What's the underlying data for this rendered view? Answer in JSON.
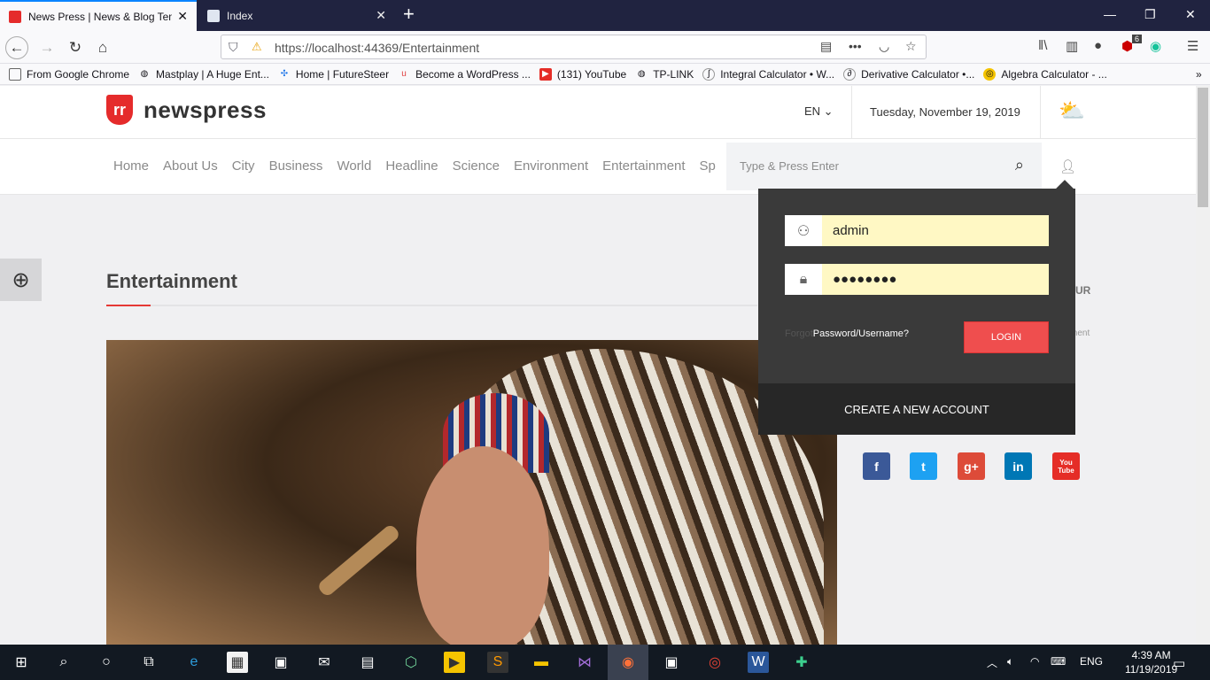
{
  "browser": {
    "tabs": [
      {
        "label": "News Press | News & Blog Temp",
        "close": "✕"
      },
      {
        "label": "Index",
        "close": "✕"
      }
    ],
    "new_tab": "+",
    "window_controls": {
      "minimize": "—",
      "restore": "❐",
      "close": "✕"
    },
    "url": "https://localhost:44369/Entertainment",
    "url_icons": {
      "reader": "reader-icon",
      "more": "•••",
      "pocket": "pocket-icon",
      "bookmark": "☆"
    },
    "toolbar_icons": [
      "library-icon",
      "sidebar-icon",
      "account-icon",
      "adblock-icon",
      "grammarly-icon",
      "menu-icon"
    ],
    "adblock_count": "6",
    "bookmarks": [
      {
        "label": "From Google Chrome",
        "icon": "folder-icon"
      },
      {
        "label": "Mastplay | A Huge Ent...",
        "icon": "globe-icon"
      },
      {
        "label": "Home | FutureSteer",
        "icon": "futuresteer-icon"
      },
      {
        "label": "Become a WordPress ...",
        "icon": "upwork-icon"
      },
      {
        "label": "(131) YouTube",
        "icon": "youtube-icon"
      },
      {
        "label": "TP-LINK",
        "icon": "globe-icon"
      },
      {
        "label": "Integral Calculator • W...",
        "icon": "calculator-icon"
      },
      {
        "label": "Derivative Calculator •...",
        "icon": "calculator-icon"
      },
      {
        "label": "Algebra Calculator - ...",
        "icon": "algebra-icon"
      }
    ],
    "bookmarks_overflow": "»"
  },
  "site": {
    "logo_text": "newspress",
    "logo_mark": "rr",
    "language": "EN ⌄",
    "date": "Tuesday, November 19, 2019",
    "menu": [
      "Home",
      "About Us",
      "City",
      "Business",
      "World",
      "Headline",
      "Science",
      "Environment",
      "Entertainment",
      "Sp"
    ],
    "search_placeholder": "Type & Press Enter",
    "section_title": "Entertainment",
    "side_text_1": "UR",
    "side_text_2": "ment"
  },
  "login": {
    "username": "admin",
    "password": "●●●●●●●●",
    "forgot_prefix": "Forgot",
    "forgot_label": "Password/Username?",
    "login_button": "LOGIN",
    "create_account": "CREATE A NEW ACCOUNT"
  },
  "social": [
    {
      "name": "facebook",
      "glyph": "f",
      "color": "#3b5998"
    },
    {
      "name": "twitter",
      "glyph": "t",
      "color": "#1da1f2"
    },
    {
      "name": "googleplus",
      "glyph": "g+",
      "color": "#dd4b39"
    },
    {
      "name": "linkedin",
      "glyph": "in",
      "color": "#0077b5"
    },
    {
      "name": "youtube",
      "glyph": "You Tube",
      "color": "#e52d27"
    }
  ],
  "taskbar": {
    "language": "ENG",
    "time": "4:39 AM",
    "date": "11/19/2019"
  }
}
